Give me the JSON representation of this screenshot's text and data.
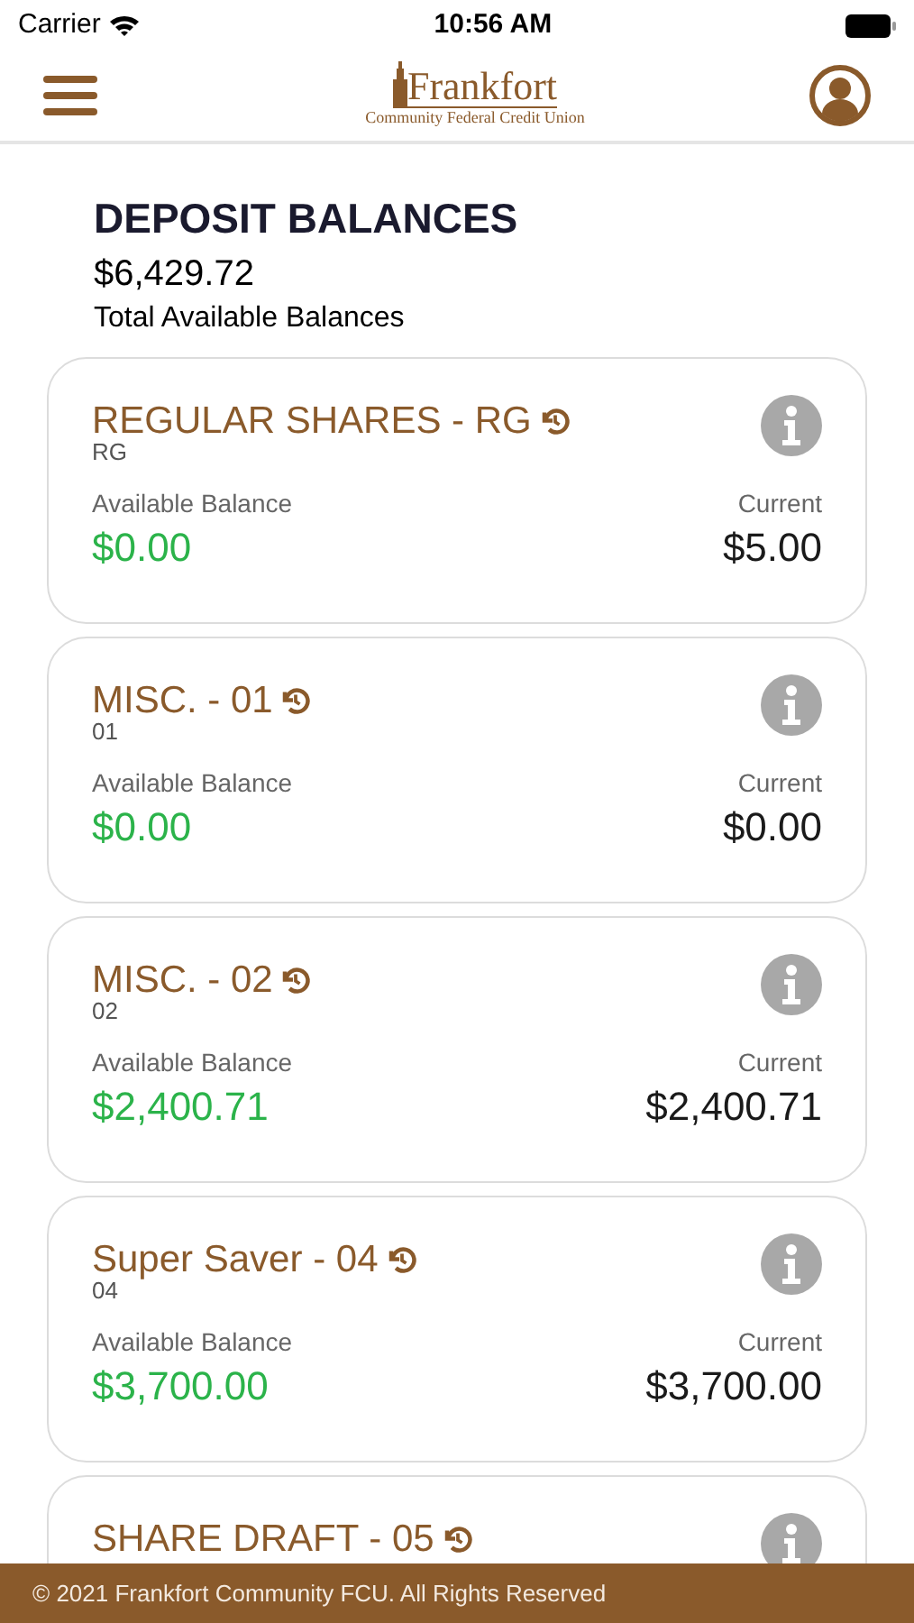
{
  "status_bar": {
    "carrier": "Carrier",
    "time": "10:56 AM"
  },
  "header": {
    "logo_name": "Frankfort",
    "logo_tagline": "Community Federal Credit Union"
  },
  "summary": {
    "title": "DEPOSIT BALANCES",
    "total": "$6,429.72",
    "total_label": "Total Available Balances"
  },
  "accounts": [
    {
      "name": "REGULAR SHARES - RG",
      "code": "RG",
      "available_label": "Available Balance",
      "available": "$0.00",
      "current_label": "Current",
      "current": "$5.00"
    },
    {
      "name": "MISC. - 01",
      "code": "01",
      "available_label": "Available Balance",
      "available": "$0.00",
      "current_label": "Current",
      "current": "$0.00"
    },
    {
      "name": "MISC. - 02",
      "code": "02",
      "available_label": "Available Balance",
      "available": "$2,400.71",
      "current_label": "Current",
      "current": "$2,400.71"
    },
    {
      "name": "Super Saver - 04",
      "code": "04",
      "available_label": "Available Balance",
      "available": "$3,700.00",
      "current_label": "Current",
      "current": "$3,700.00"
    },
    {
      "name": "SHARE DRAFT - 05"
    }
  ],
  "footer": "© 2021 Frankfort Community FCU. All Rights Reserved"
}
